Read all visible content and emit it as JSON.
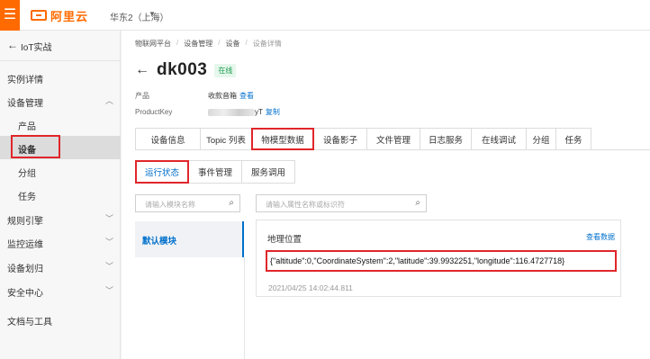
{
  "topbar": {
    "logo_text": "阿里云",
    "region": "华东2（上海）"
  },
  "sidebar": {
    "back_label": "IoT实战",
    "items": [
      {
        "label": "实例详情",
        "chevron": false
      },
      {
        "label": "设备管理",
        "chevron": "up"
      },
      {
        "label": "产品",
        "chevron": false
      },
      {
        "label": "设备",
        "chevron": false
      },
      {
        "label": "分组",
        "chevron": false
      },
      {
        "label": "任务",
        "chevron": false
      },
      {
        "label": "规则引擎",
        "chevron": "down"
      },
      {
        "label": "监控运维",
        "chevron": "down"
      },
      {
        "label": "设备划归",
        "chevron": "down"
      },
      {
        "label": "安全中心",
        "chevron": "down"
      },
      {
        "label": "文档与工具",
        "chevron": false
      }
    ]
  },
  "breadcrumb": [
    "物联网平台",
    "设备管理",
    "设备",
    "设备详情"
  ],
  "device": {
    "name": "dk003",
    "status": "在线"
  },
  "meta": {
    "product_label": "产品",
    "product_value": "收款音箱",
    "product_link": "查看",
    "productkey_label": "ProductKey",
    "productkey_suffix": "yT",
    "productkey_link": "复制"
  },
  "tabs": [
    "设备信息",
    "Topic 列表",
    "物模型数据",
    "设备影子",
    "文件管理",
    "日志服务",
    "在线调试",
    "分组",
    "任务"
  ],
  "subtabs": [
    "运行状态",
    "事件管理",
    "服务调用"
  ],
  "search": {
    "module_placeholder": "请输入模块名称",
    "property_placeholder": "请输入属性名称或标识符"
  },
  "module": {
    "label": "默认模块"
  },
  "property": {
    "name": "地理位置",
    "view_link": "查看数据",
    "value": "{\"altitude\":0,\"CoordinateSystem\":2,\"latitude\":39.9932251,\"longitude\":116.4727718}",
    "timestamp": "2021/04/25 14:02:44.811"
  },
  "colors": {
    "brand": "#ff6a00",
    "link": "#0070cc",
    "highlight": "#e0262b"
  }
}
